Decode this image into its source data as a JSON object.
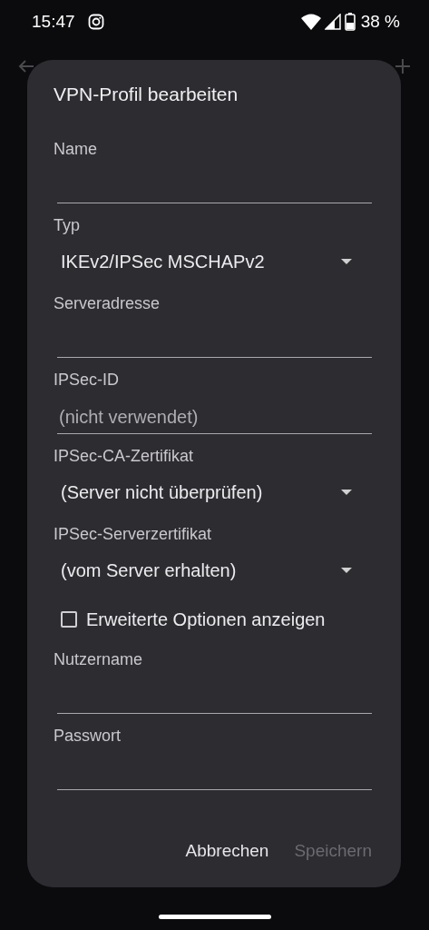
{
  "status_bar": {
    "time": "15:47",
    "battery": "38 %"
  },
  "dialog": {
    "title": "VPN-Profil bearbeiten",
    "fields": [
      {
        "kind": "text",
        "label": "Name"
      },
      {
        "kind": "select",
        "label": "Typ",
        "value": "IKEv2/IPSec MSCHAPv2"
      },
      {
        "kind": "text",
        "label": "Serveradresse"
      },
      {
        "kind": "text",
        "label": "IPSec-ID",
        "placeholder": "(nicht verwendet)"
      },
      {
        "kind": "select",
        "label": "IPSec-CA-Zertifikat",
        "value": "(Server nicht überprüfen)"
      },
      {
        "kind": "select",
        "label": "IPSec-Serverzertifikat",
        "value": "(vom Server erhalten)"
      },
      {
        "kind": "checkbox",
        "label": "Erweiterte Optionen anzeigen",
        "checked": false
      },
      {
        "kind": "text",
        "label": "Nutzername"
      },
      {
        "kind": "text",
        "label": "Passwort"
      }
    ],
    "buttons": [
      {
        "label": "Abbrechen",
        "disabled": false
      },
      {
        "label": "Speichern",
        "disabled": true
      }
    ]
  }
}
